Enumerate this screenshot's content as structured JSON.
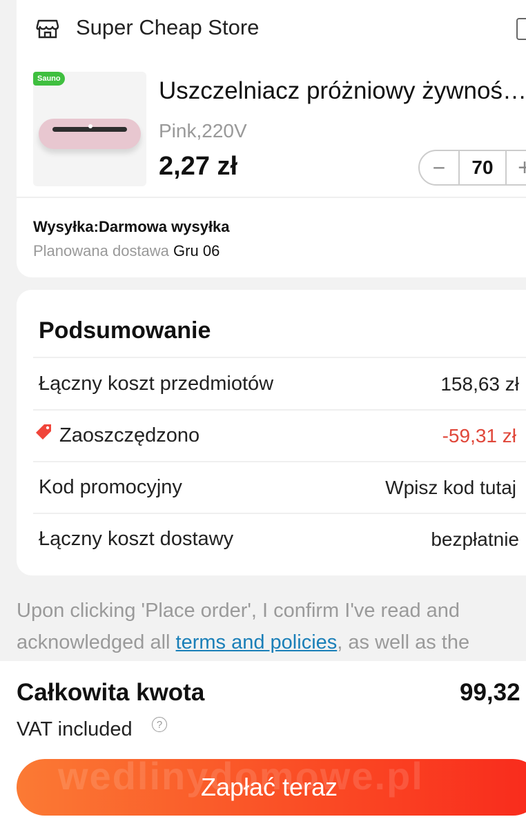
{
  "store": {
    "name": "Super Cheap Store",
    "icon": "store-icon"
  },
  "product": {
    "badge": "Sauno",
    "title": "Uszczelniacz próżniowy żywnoś…",
    "variant": "Pink,220V",
    "price": "2,27 zł",
    "quantity": "70",
    "minus_symbol": "−",
    "plus_symbol": "+"
  },
  "shipping": {
    "label": "Wysyłka:Darmowa wysyłka",
    "delivery_label": "Planowana dostawa",
    "delivery_date": "Gru 06"
  },
  "summary": {
    "title": "Podsumowanie",
    "rows": [
      {
        "label": "Łączny koszt przedmiotów",
        "value": "158,63 zł"
      },
      {
        "label": "Zaoszczędzono",
        "value": "-59,31 zł"
      },
      {
        "label": "Kod promocyjny",
        "value": "Wpisz kod tutaj"
      },
      {
        "label": "Łączny koszt dostawy",
        "value": "bezpłatnie"
      }
    ]
  },
  "notice": {
    "before": "Upon clicking 'Place order', I confirm I've read and acknowledged all ",
    "link": "terms and policies",
    "after": ", as well as the"
  },
  "footer": {
    "total_label": "Całkowita kwota",
    "total_value": "99,32",
    "vat_label": "VAT included",
    "help_symbol": "?",
    "pay_button": "Zapłać teraz",
    "watermark": "wedlinydomowe.pl"
  },
  "colors": {
    "accent_start": "#fb7a34",
    "accent_end": "#f92a1c",
    "savings": "#e0473a",
    "link": "#1a7fb8"
  }
}
